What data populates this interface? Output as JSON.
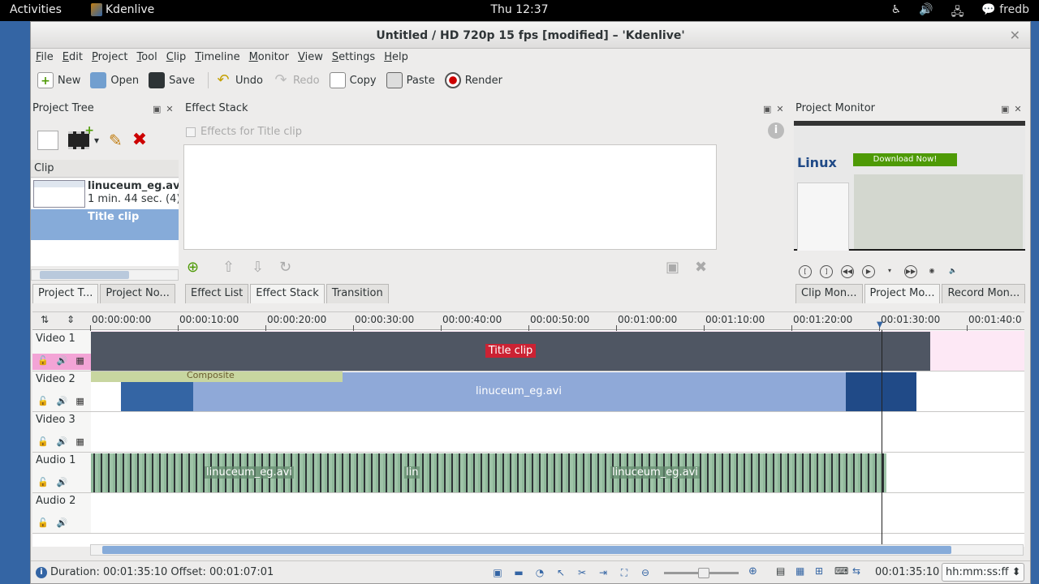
{
  "topbar": {
    "activities": "Activities",
    "app_name": "Kdenlive",
    "clock": "Thu 12:37",
    "user": "fredb"
  },
  "window": {
    "title": "Untitled / HD 720p 15 fps [modified] – 'Kdenlive'",
    "close": "✕"
  },
  "menu": [
    "File",
    "Edit",
    "Project",
    "Tool",
    "Clip",
    "Timeline",
    "Monitor",
    "View",
    "Settings",
    "Help"
  ],
  "toolbar": {
    "new": "New",
    "open": "Open",
    "save": "Save",
    "undo": "Undo",
    "redo": "Redo",
    "copy": "Copy",
    "paste": "Paste",
    "render": "Render"
  },
  "project_tree": {
    "title": "Project Tree",
    "column": "Clip",
    "clips": [
      {
        "name": "linuceum_eg.avi",
        "sub": "1 min. 44 sec. (4)"
      },
      {
        "name": "Title clip",
        "sub": ""
      }
    ],
    "tabs": [
      "Project T...",
      "Project No..."
    ]
  },
  "effect_stack": {
    "title": "Effect Stack",
    "checkbox": "Effects for Title clip",
    "tabs": [
      "Effect List",
      "Effect Stack",
      "Transition"
    ]
  },
  "project_monitor": {
    "title": "Project Monitor",
    "logo": "Linux",
    "download": "Download Now!",
    "tabs": [
      "Clip Mon...",
      "Project Mo...",
      "Record Mon..."
    ]
  },
  "timeline": {
    "ruler": [
      "00:00:00:00",
      "00:00:10:00",
      "00:00:20:00",
      "00:00:30:00",
      "00:00:40:00",
      "00:00:50:00",
      "00:01:00:00",
      "00:01:10:00",
      "00:01:20:00",
      "00:01:30:00",
      "00:01:40:0"
    ],
    "tracks": [
      "Video 1",
      "Video 2",
      "Video 3",
      "Audio 1",
      "Audio 2"
    ],
    "clips": {
      "title_clip": "Title clip",
      "composite": "Composite",
      "video": "linuceum_eg.avi",
      "audio_a": "linuceum_eg.avi",
      "audio_b": "lin",
      "audio_c": "linuceum_eg.avi"
    }
  },
  "status": {
    "text": "Duration: 00:01:35:10 Offset: 00:01:07:01",
    "time": "00:01:35:10",
    "format": "hh:mm:ss:ff"
  }
}
